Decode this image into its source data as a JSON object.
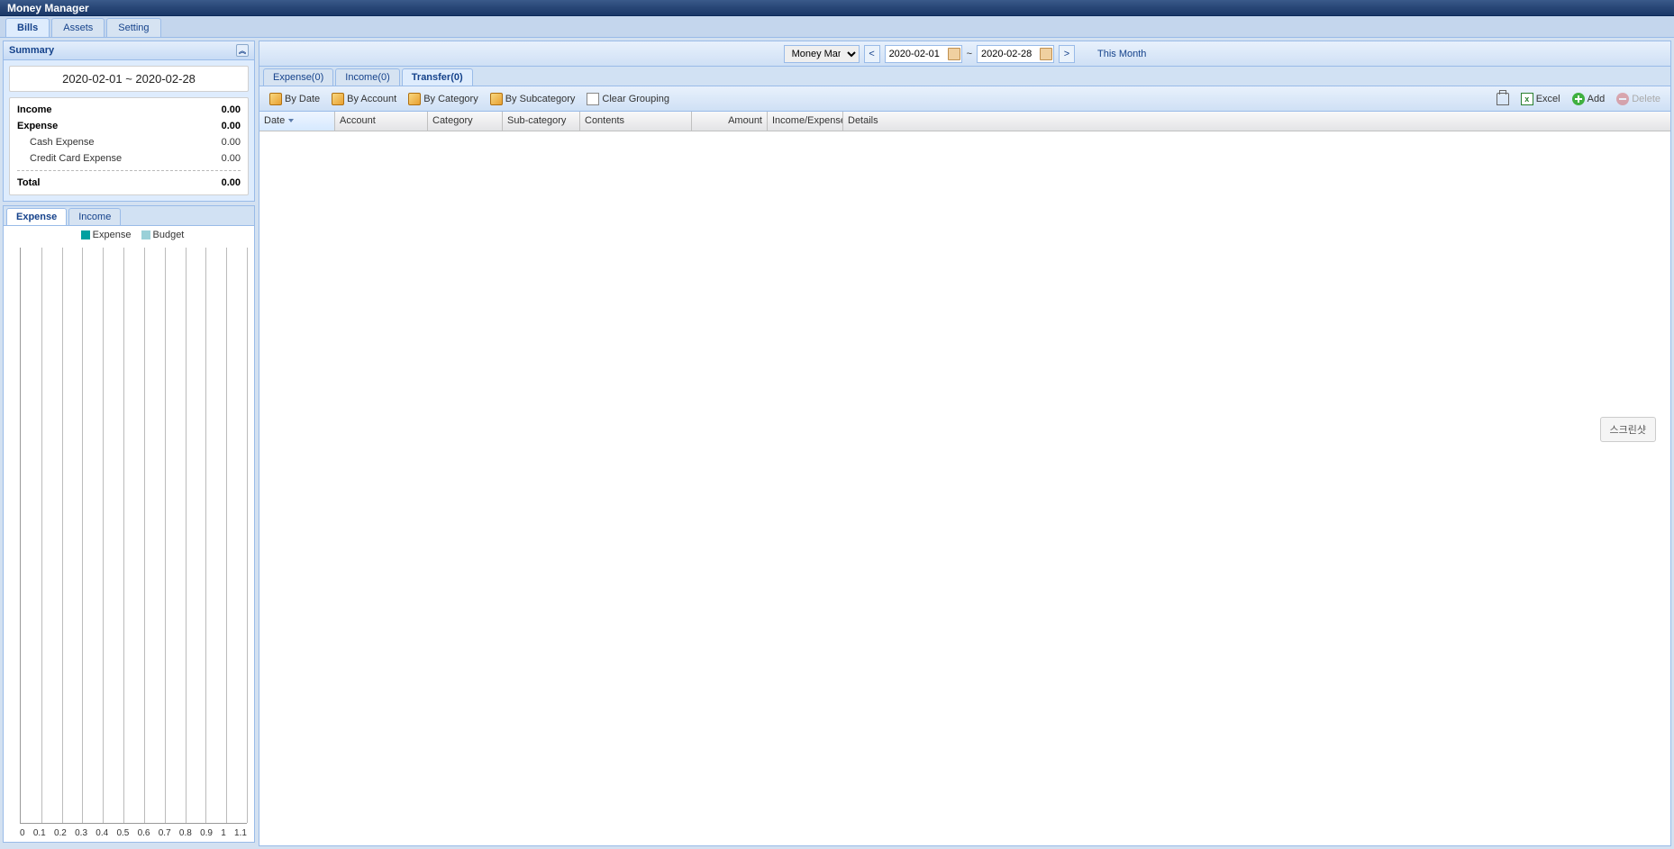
{
  "app": {
    "title": "Money Manager"
  },
  "mainTabs": {
    "bills": "Bills",
    "assets": "Assets",
    "setting": "Setting"
  },
  "summary": {
    "panelTitle": "Summary",
    "dateRange": "2020-02-01  ~  2020-02-28",
    "rows": {
      "incomeLabel": "Income",
      "incomeVal": "0.00",
      "expenseLabel": "Expense",
      "expenseVal": "0.00",
      "cashLabel": "Cash Expense",
      "cashVal": "0.00",
      "creditLabel": "Credit Card Expense",
      "creditVal": "0.00",
      "totalLabel": "Total",
      "totalVal": "0.00"
    }
  },
  "chartTabs": {
    "expense": "Expense",
    "income": "Income"
  },
  "legend": {
    "expense": "Expense",
    "budget": "Budget"
  },
  "chart_data": {
    "type": "bar",
    "categories": [],
    "series": [
      {
        "name": "Expense",
        "values": []
      },
      {
        "name": "Budget",
        "values": []
      }
    ],
    "title": "",
    "xlabel": "",
    "ylabel": "",
    "xlim": [
      0,
      1.1
    ],
    "x_ticks": [
      "0",
      "0.1",
      "0.2",
      "0.3",
      "0.4",
      "0.5",
      "0.6",
      "0.7",
      "0.8",
      "0.9",
      "1",
      "1.1"
    ],
    "grid": true,
    "legend_position": "top"
  },
  "filter": {
    "bookOptions": [
      "Money Manager"
    ],
    "bookSelected": "Money Manager",
    "dateFrom": "2020-02-01",
    "dateTo": "2020-02-28",
    "tilde": "~",
    "prev": "<",
    "next": ">",
    "thisMonth": "This Month"
  },
  "typeTabs": {
    "expense": "Expense(0)",
    "income": "Income(0)",
    "transfer": "Transfer(0)"
  },
  "toolbar": {
    "byDate": "By Date",
    "byAccount": "By Account",
    "byCategory": "By Category",
    "bySubcategory": "By Subcategory",
    "clearGrouping": "Clear Grouping",
    "excel": "Excel",
    "add": "Add",
    "delete": "Delete"
  },
  "gridCols": {
    "date": "Date",
    "account": "Account",
    "category": "Category",
    "subcategory": "Sub-category",
    "contents": "Contents",
    "amount": "Amount",
    "incExp": "Income/Expense",
    "details": "Details"
  },
  "floating": {
    "screenshot": "스크린샷"
  }
}
